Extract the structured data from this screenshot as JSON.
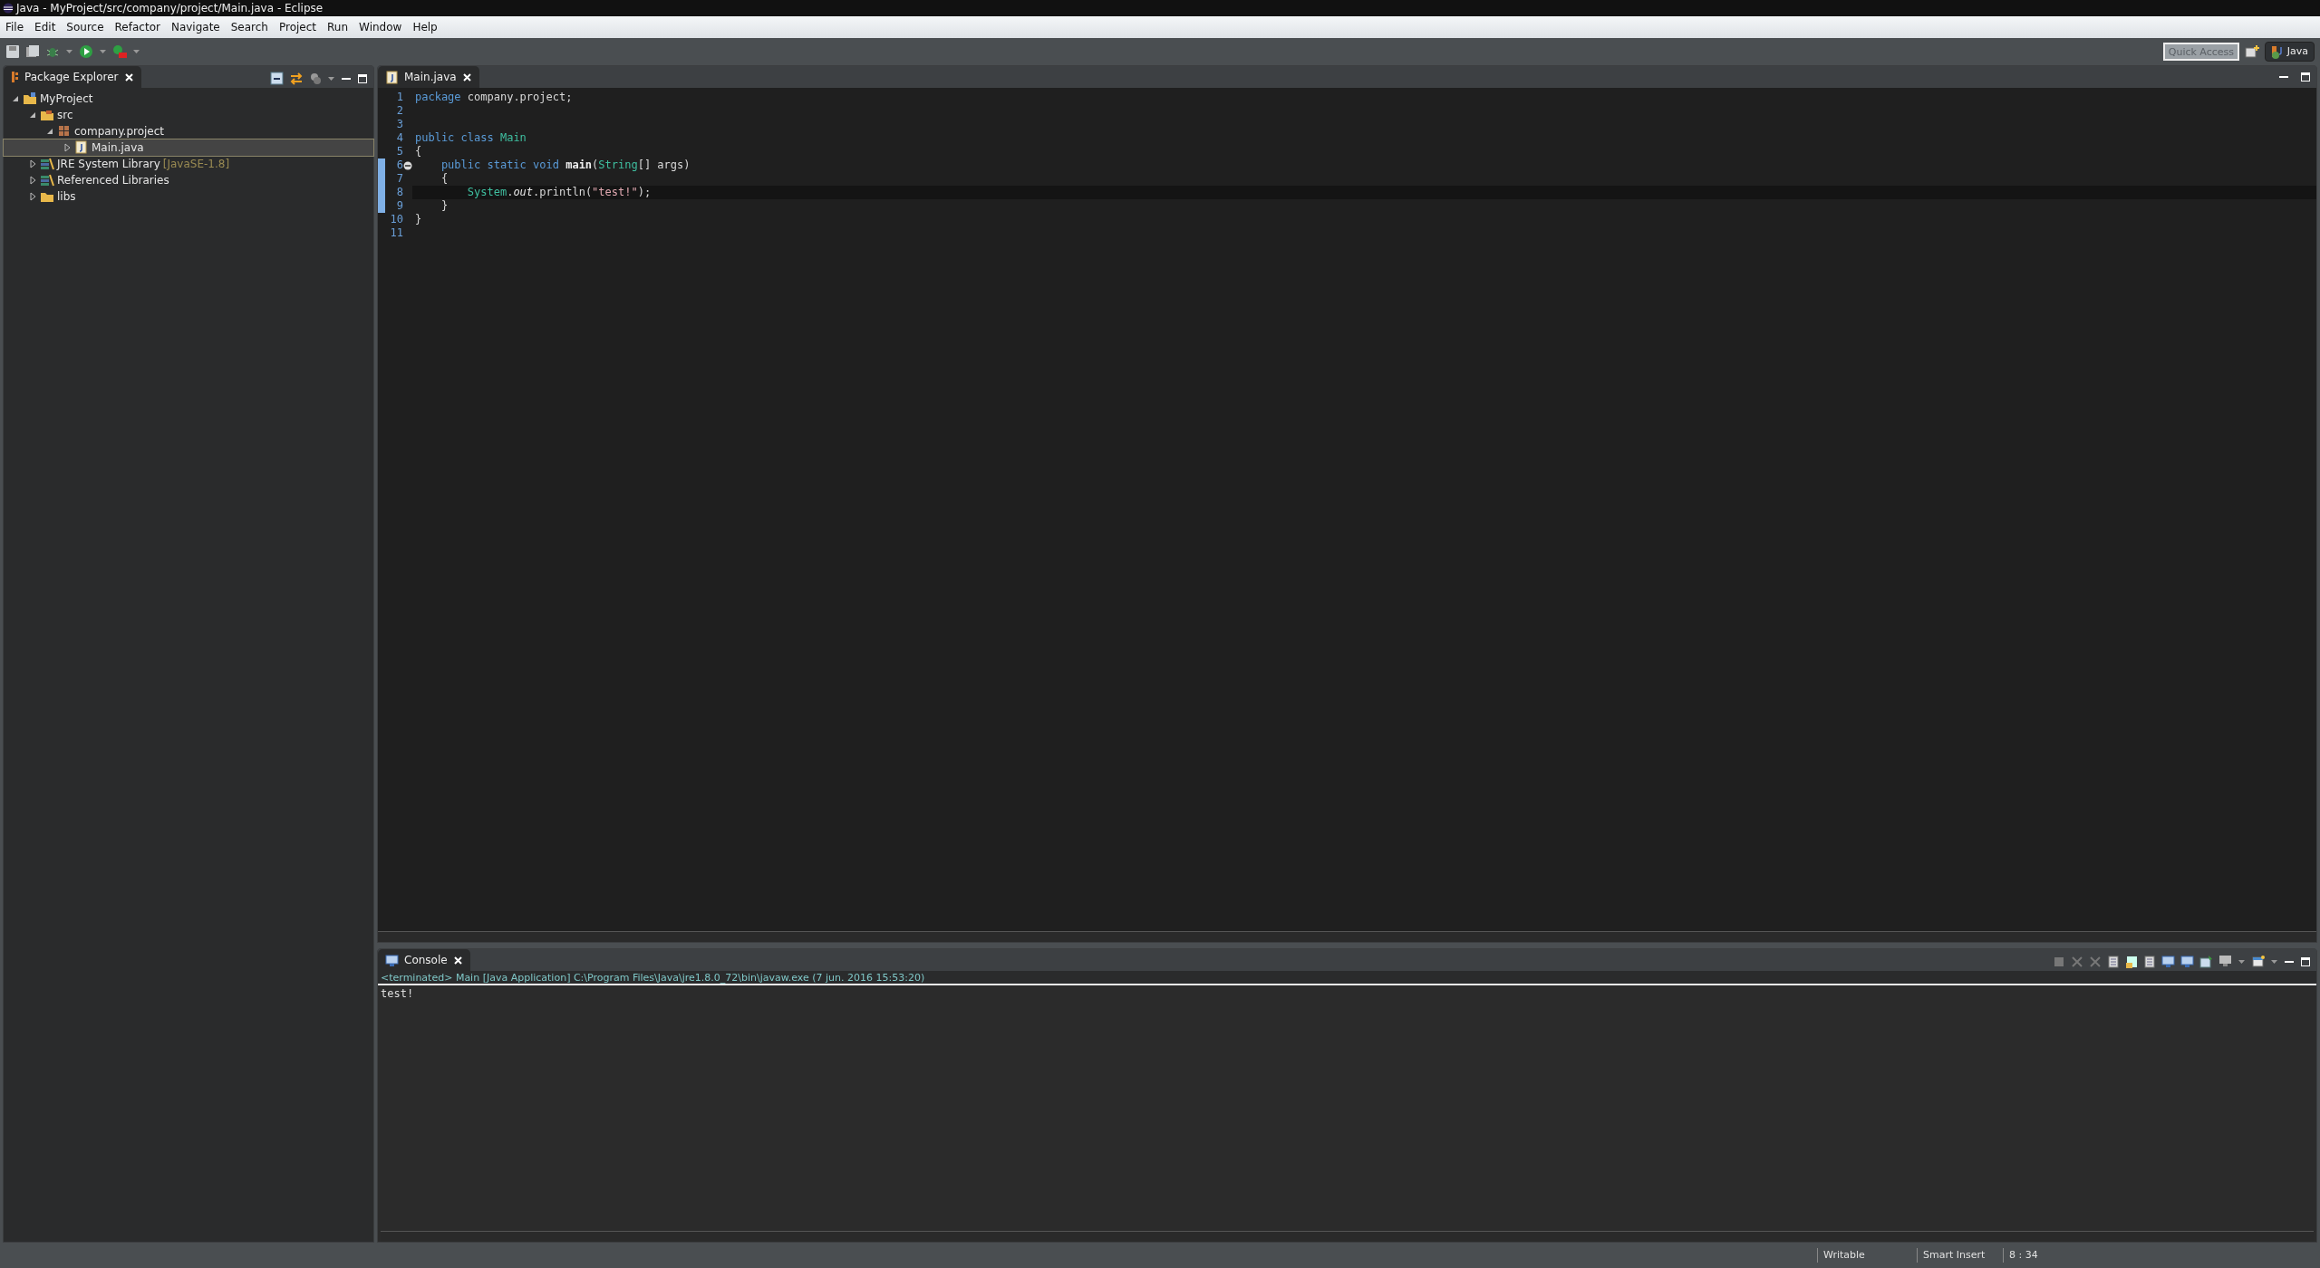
{
  "window": {
    "title": "Java - MyProject/src/company/project/Main.java - Eclipse"
  },
  "menu": [
    "File",
    "Edit",
    "Source",
    "Refactor",
    "Navigate",
    "Search",
    "Project",
    "Run",
    "Window",
    "Help"
  ],
  "quick_access": {
    "placeholder": "Quick Access"
  },
  "perspectives": [
    {
      "label": "Java",
      "selected": true
    }
  ],
  "package_explorer": {
    "title": "Package Explorer",
    "tree": [
      {
        "label": "MyProject",
        "kind": "project",
        "expanded": true,
        "selected": false,
        "children": [
          {
            "label": "src",
            "kind": "source-folder",
            "expanded": true,
            "selected": false,
            "children": [
              {
                "label": "company.project",
                "kind": "package",
                "expanded": true,
                "selected": false,
                "children": [
                  {
                    "label": "Main.java",
                    "kind": "java-file",
                    "expanded": false,
                    "selected": true
                  }
                ]
              }
            ]
          },
          {
            "label": "JRE System Library",
            "decoration": "[JavaSE-1.8]",
            "kind": "library",
            "expanded": false,
            "selected": false
          },
          {
            "label": "Referenced Libraries",
            "kind": "library",
            "expanded": false,
            "selected": false
          },
          {
            "label": "libs",
            "kind": "folder",
            "expanded": false,
            "selected": false
          }
        ]
      }
    ]
  },
  "editor": {
    "tabs": [
      {
        "label": "Main.java",
        "selected": true
      }
    ],
    "lines": [
      {
        "number": "1",
        "changed": false,
        "fold": false,
        "current": false,
        "tokens": [
          {
            "text": "package",
            "kind": "keyword"
          },
          {
            "text": " company.project;",
            "kind": "plain"
          }
        ]
      },
      {
        "number": "2",
        "changed": false,
        "fold": false,
        "current": false
      },
      {
        "number": "3",
        "changed": false,
        "fold": false,
        "current": false
      },
      {
        "number": "4",
        "changed": false,
        "fold": false,
        "current": false,
        "tokens": [
          {
            "text": "public class",
            "kind": "keyword"
          },
          {
            "text": " Main",
            "kind": "class"
          }
        ]
      },
      {
        "number": "5",
        "changed": false,
        "fold": false,
        "current": false,
        "tokens": [
          {
            "text": "{",
            "kind": "plain"
          }
        ]
      },
      {
        "number": "6",
        "changed": true,
        "fold": true,
        "current": false,
        "tokens": [
          {
            "text": "    public static void",
            "kind": "keyword"
          },
          {
            "text": " main",
            "kind": "method"
          },
          {
            "text": "(",
            "kind": "plain"
          },
          {
            "text": "String",
            "kind": "class"
          },
          {
            "text": "[] args)",
            "kind": "plain"
          }
        ]
      },
      {
        "number": "7",
        "changed": true,
        "fold": false,
        "current": false,
        "tokens": [
          {
            "text": "    {",
            "kind": "plain"
          }
        ]
      },
      {
        "number": "8",
        "changed": true,
        "fold": false,
        "current": true,
        "tokens": [
          {
            "text": "        System",
            "kind": "class"
          },
          {
            "text": ".",
            "kind": "plain"
          },
          {
            "text": "out",
            "kind": "field"
          },
          {
            "text": ".println(",
            "kind": "plain"
          },
          {
            "text": "\"test!\"",
            "kind": "string"
          },
          {
            "text": ");",
            "kind": "plain"
          }
        ]
      },
      {
        "number": "9",
        "changed": true,
        "fold": false,
        "current": false,
        "tokens": [
          {
            "text": "    }",
            "kind": "plain"
          }
        ]
      },
      {
        "number": "10",
        "changed": false,
        "fold": false,
        "current": false,
        "tokens": [
          {
            "text": "}",
            "kind": "plain"
          }
        ]
      },
      {
        "number": "11",
        "changed": false,
        "fold": false,
        "current": false
      }
    ]
  },
  "console": {
    "title": "Console",
    "description": "<terminated> Main [Java Application] C:\\Program Files\\Java\\jre1.8.0_72\\bin\\javaw.exe (7 jun. 2016 15:53:20)",
    "output": "test!"
  },
  "status_bar": [
    "Writable",
    "Smart Insert",
    "8 : 34"
  ]
}
